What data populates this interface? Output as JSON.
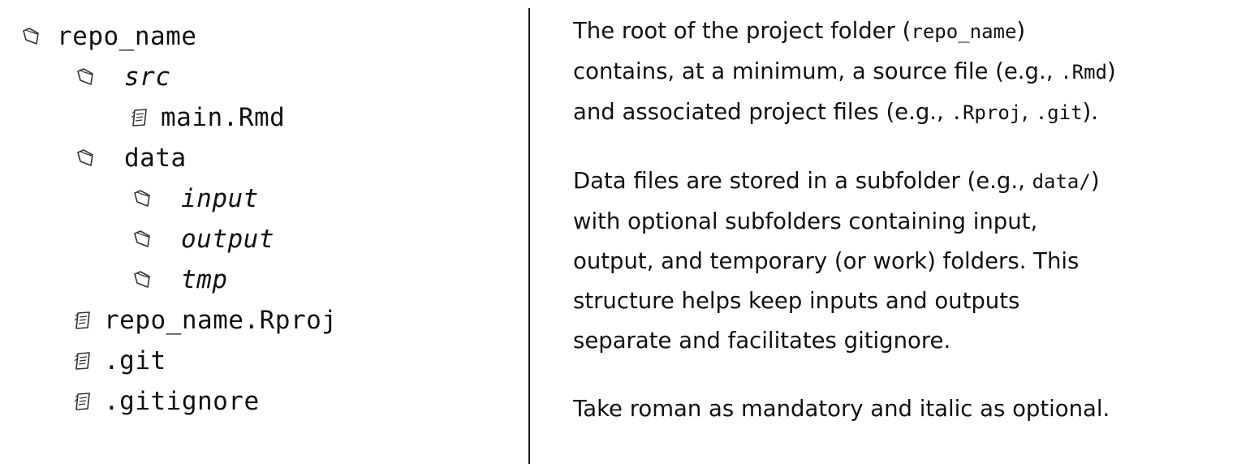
{
  "tree": {
    "root": {
      "label": "repo_name",
      "icon": "folder-icon"
    },
    "src": {
      "label": "src",
      "icon": "folder-icon"
    },
    "main_rmd": {
      "label": "main.Rmd",
      "icon": "file-icon"
    },
    "data": {
      "label": "data",
      "icon": "folder-icon"
    },
    "input": {
      "label": "input",
      "icon": "folder-icon"
    },
    "output": {
      "label": "output",
      "icon": "folder-icon"
    },
    "tmp": {
      "label": "tmp",
      "icon": "folder-icon"
    },
    "rproj": {
      "label": "repo_name.Rproj",
      "icon": "file-icon"
    },
    "git": {
      "label": ".git",
      "icon": "file-icon"
    },
    "gitignore": {
      "label": ".gitignore",
      "icon": "file-icon"
    }
  },
  "notes": {
    "p1": {
      "l1_a": "The root of the project folder (",
      "l1_code": "repo_name",
      "l1_b": ")",
      "l2_a": "contains, at a minimum, a source file (e.g., ",
      "l2_code": ".Rmd",
      "l2_b": ")",
      "l3_a": "and associated project files (e.g., ",
      "l3_code1": ".Rproj",
      "l3_sep": ", ",
      "l3_code2": ".git",
      "l3_b": ")."
    },
    "p2": {
      "l1_a": "Data files are stored in a subfolder (e.g., ",
      "l1_code": "data/",
      "l1_b": ")",
      "l2": "with optional subfolders containing input,",
      "l3": "output, and temporary (or work) folders. This",
      "l4": "structure helps keep inputs and outputs",
      "l5": "separate and facilitates gitignore."
    },
    "p3": "Take roman as mandatory and italic as optional."
  }
}
